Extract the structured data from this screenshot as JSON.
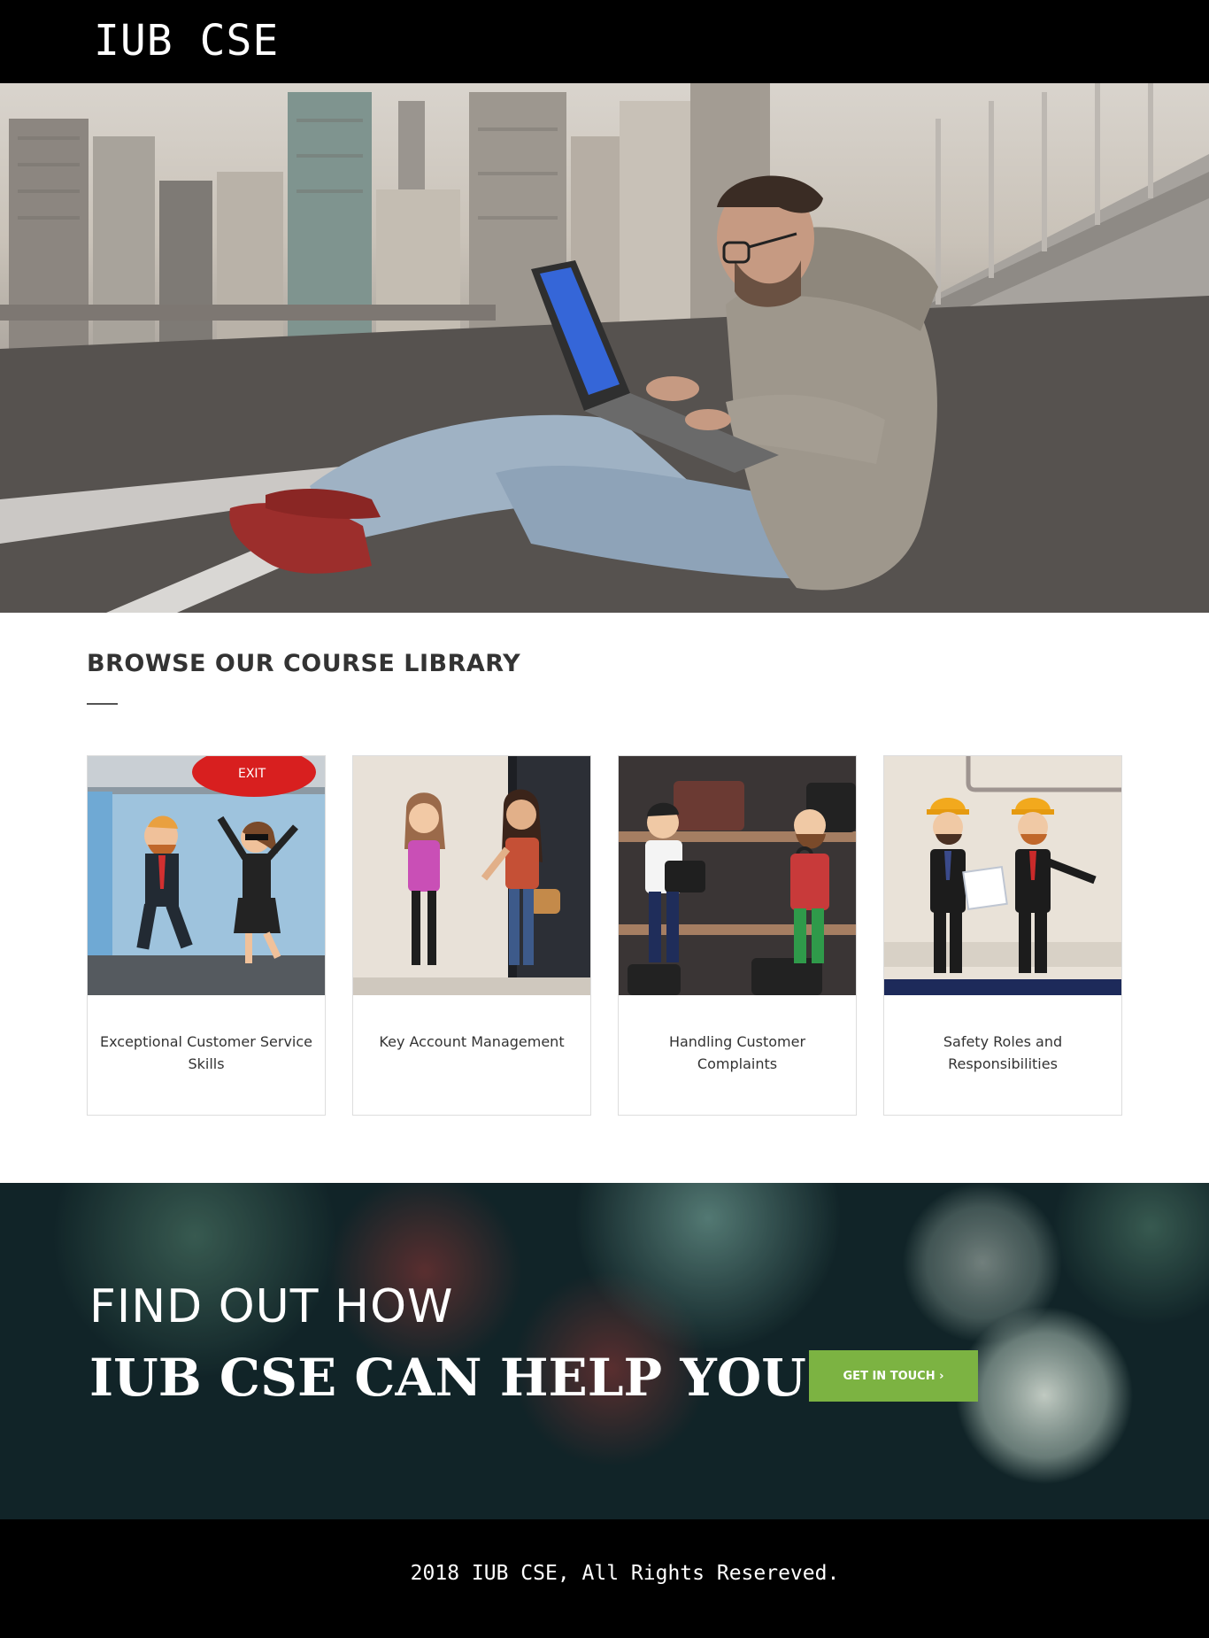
{
  "header": {
    "brand": "IUB CSE"
  },
  "library": {
    "title": "BROWSE OUR COURSE LIBRARY",
    "courses": [
      {
        "label": "Exceptional Customer Service Skills",
        "image_sign": "EXIT"
      },
      {
        "label": "Key Account Management"
      },
      {
        "label": "Handling Customer Complaints"
      },
      {
        "label": "Safety Roles and Responsibilities"
      }
    ]
  },
  "cta": {
    "line1": "FIND OUT HOW",
    "line2": "IUB CSE CAN HELP YOU",
    "button": "GET IN TOUCH ›"
  },
  "footer": {
    "text": "2018 IUB CSE, All Rights Resereved."
  },
  "colors": {
    "accent_green": "#7cb342",
    "header_bg": "#000000"
  }
}
